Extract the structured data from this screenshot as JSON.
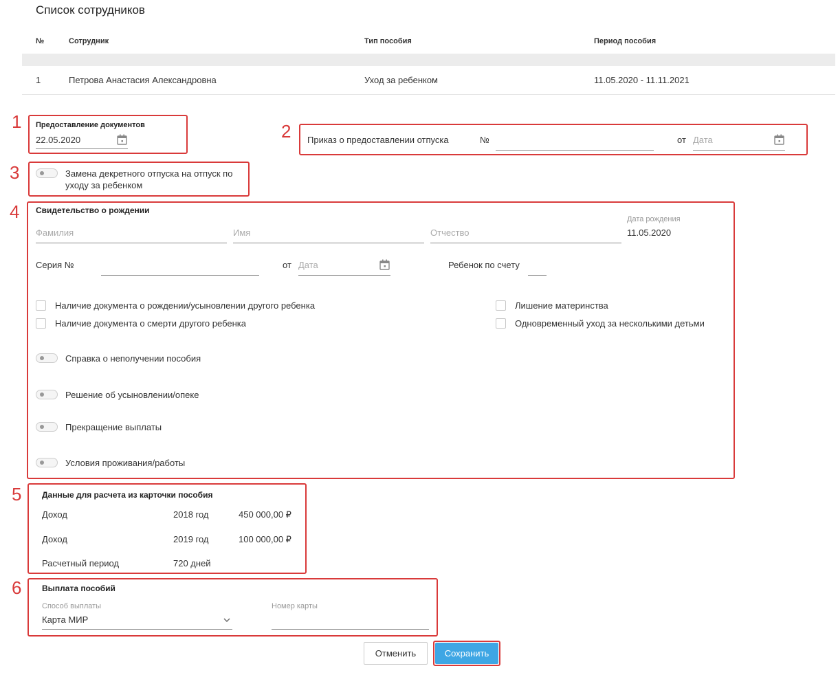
{
  "page_title": "Список сотрудников",
  "table": {
    "headers": [
      "№",
      "Сотрудник",
      "Тип пособия",
      "Период пособия"
    ],
    "rows": [
      {
        "num": "1",
        "employee": "Петрова Анастасия Александровна",
        "benefit_type": "Уход за ребенком",
        "period": "11.05.2020 - 11.11.2021"
      }
    ]
  },
  "markers": [
    "1",
    "2",
    "3",
    "4",
    "5",
    "6"
  ],
  "documents": {
    "label": "Предоставление документов",
    "date": "22.05.2020"
  },
  "order": {
    "label": "Приказ о предоставлении отпуска",
    "number_label": "№",
    "from_label": "от",
    "date_placeholder": "Дата"
  },
  "replacement_toggle": {
    "label_line1": "Замена декретного отпуска на отпуск по",
    "label_line2": "уходу за ребенком"
  },
  "birth_certificate": {
    "title": "Свидетельство о рождении",
    "last_name_placeholder": "Фамилия",
    "first_name_placeholder": "Имя",
    "patronymic_placeholder": "Отчество",
    "birth_date_label": "Дата рождения",
    "birth_date_value": "11.05.2020",
    "series_label": "Серия №",
    "from_label": "от",
    "date_placeholder": "Дата",
    "child_count_label": "Ребенок по счету",
    "checkboxes": {
      "other_child_birth_doc": "Наличие документа о рождении/усыновлении другого ребенка",
      "other_child_death_doc": "Наличие документа о смерти другого ребенка",
      "deprivation_maternity": "Лишение материнства",
      "simultaneous_care": "Одновременный уход за несколькими детьми"
    },
    "toggles": {
      "no_benefit_certificate": "Справка о неполучении пособия",
      "adoption_decision": "Решение об усыновлении/опеке",
      "payment_termination": "Прекращение выплаты",
      "living_conditions": "Условия проживания/работы"
    }
  },
  "calculation": {
    "title": "Данные для расчета из карточки пособия",
    "rows": [
      {
        "label": "Доход",
        "year": "2018 год",
        "amount": "450 000,00 ₽"
      },
      {
        "label": "Доход",
        "year": "2019 год",
        "amount": "100 000,00 ₽"
      },
      {
        "label": "Расчетный период",
        "year": "720 дней",
        "amount": ""
      }
    ]
  },
  "payment": {
    "title": "Выплата пособий",
    "method_label": "Способ выплаты",
    "method_value": "Карта МИР",
    "card_label": "Номер карты",
    "card_value": ""
  },
  "buttons": {
    "cancel": "Отменить",
    "save": "Сохранить"
  },
  "colors": {
    "highlight_red": "#d93a3a",
    "primary_blue": "#3ea6e4"
  }
}
